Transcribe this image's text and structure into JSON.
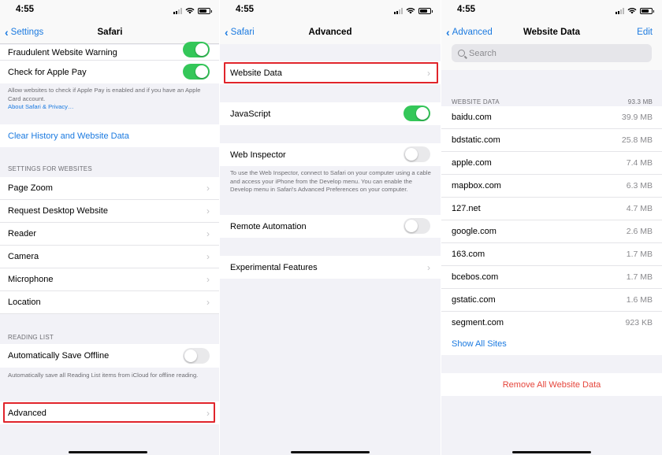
{
  "status_time": "4:55",
  "colors": {
    "accent": "#1b7ae0",
    "toggle_on": "#34c759",
    "destructive": "#e5453b",
    "highlight_border": "#e0242b"
  },
  "screen1": {
    "back_label": "Settings",
    "title": "Safari",
    "fraud_warning_label": "Fraudulent Website Warning",
    "apple_pay_label": "Check for Apple Pay",
    "apple_pay_note": "Allow websites to check if Apple Pay is enabled and if you have an Apple Card account.",
    "apple_pay_link": "About Safari & Privacy…",
    "clear_history_label": "Clear History and Website Data",
    "settings_header": "SETTINGS FOR WEBSITES",
    "website_settings": [
      "Page Zoom",
      "Request Desktop Website",
      "Reader",
      "Camera",
      "Microphone",
      "Location"
    ],
    "reading_list_header": "READING LIST",
    "save_offline_label": "Automatically Save Offline",
    "save_offline_note": "Automatically save all Reading List items from iCloud for offline reading.",
    "advanced_label": "Advanced"
  },
  "screen2": {
    "back_label": "Safari",
    "title": "Advanced",
    "website_data_label": "Website Data",
    "javascript_label": "JavaScript",
    "web_inspector_label": "Web Inspector",
    "web_inspector_note": "To use the Web Inspector, connect to Safari on your computer using a cable and access your iPhone from the Develop menu. You can enable the Develop menu in Safari's Advanced Preferences on your computer.",
    "remote_automation_label": "Remote Automation",
    "experimental_label": "Experimental Features"
  },
  "screen3": {
    "back_label": "Advanced",
    "title": "Website Data",
    "edit_label": "Edit",
    "search_placeholder": "Search",
    "section_header": "WEBSITE DATA",
    "total_size": "93.3 MB",
    "sites": [
      {
        "domain": "baidu.com",
        "size": "39.9 MB"
      },
      {
        "domain": "bdstatic.com",
        "size": "25.8 MB"
      },
      {
        "domain": "apple.com",
        "size": "7.4 MB"
      },
      {
        "domain": "mapbox.com",
        "size": "6.3 MB"
      },
      {
        "domain": "127.net",
        "size": "4.7 MB"
      },
      {
        "domain": "google.com",
        "size": "2.6 MB"
      },
      {
        "domain": "163.com",
        "size": "1.7 MB"
      },
      {
        "domain": "bcebos.com",
        "size": "1.7 MB"
      },
      {
        "domain": "gstatic.com",
        "size": "1.6 MB"
      },
      {
        "domain": "segment.com",
        "size": "923 KB"
      }
    ],
    "show_all_label": "Show All Sites",
    "remove_all_label": "Remove All Website Data"
  }
}
